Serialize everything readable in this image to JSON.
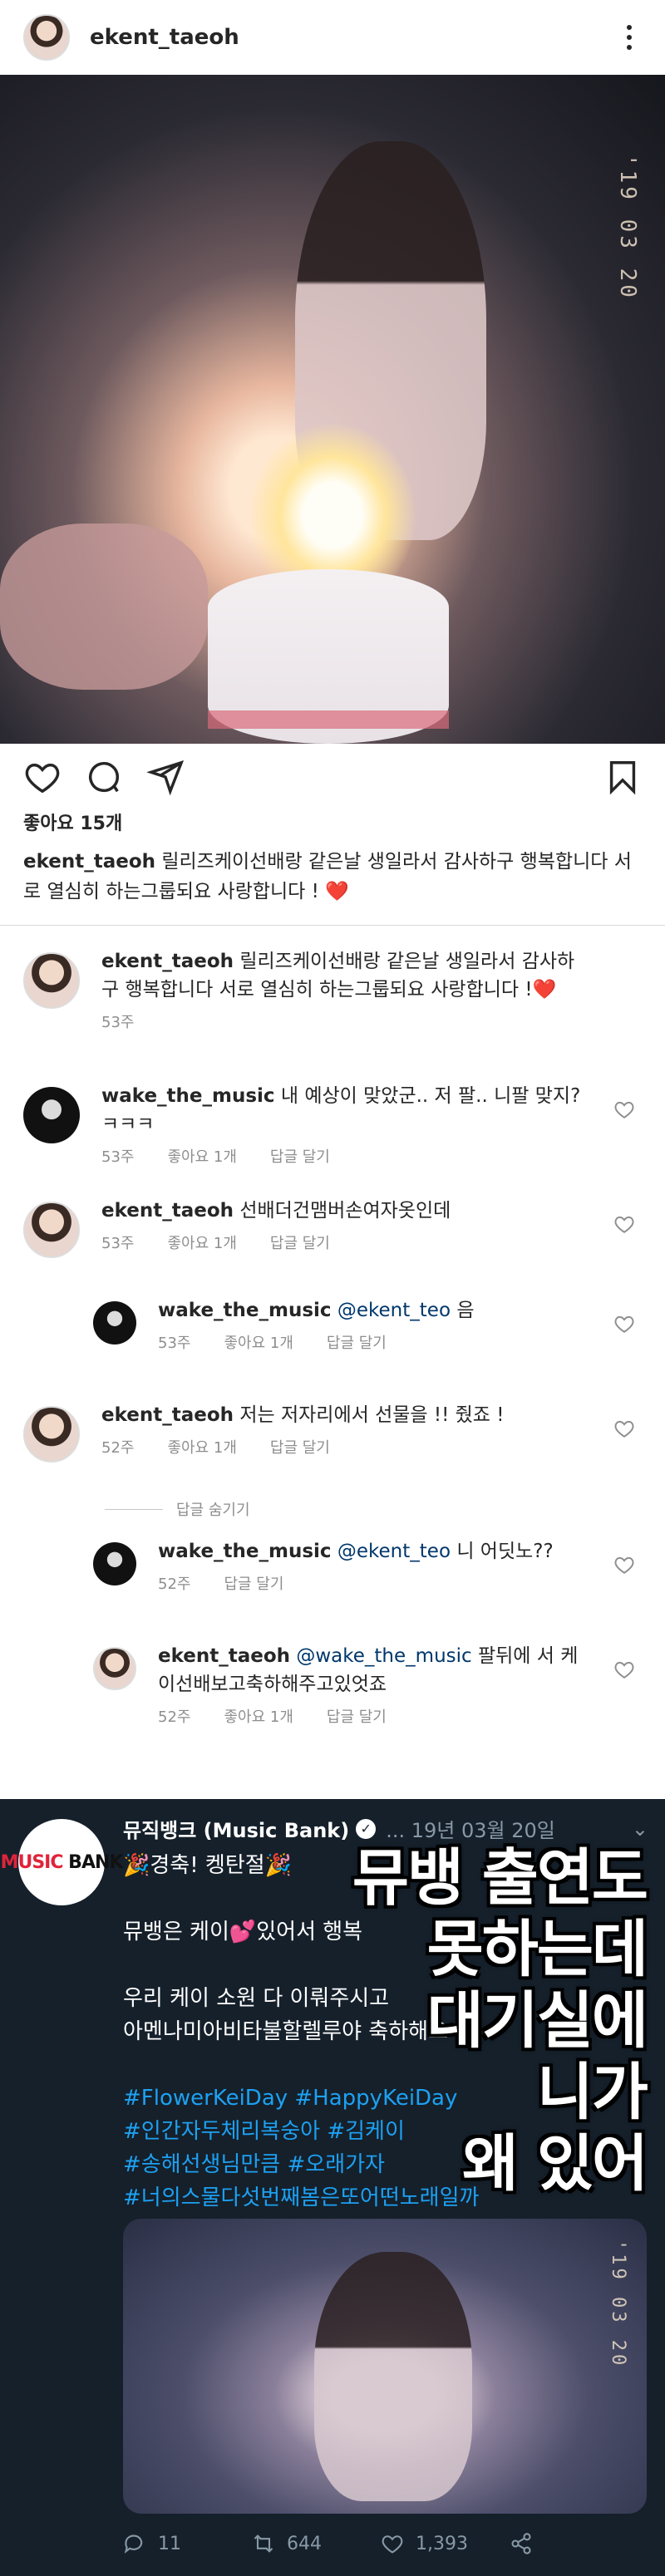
{
  "instagram": {
    "username": "ekent_taeoh",
    "likes": "좋아요 15개",
    "caption": {
      "user": "ekent_taeoh",
      "text": "릴리즈케이선배랑 같은날 생일라서 감사하구 행복합니다 서로 열심히 하는그룹되요 사랑합니다 !",
      "emoji": "❤️"
    },
    "photo_date": "'19 03 20",
    "comments": [
      {
        "user": "ekent_taeoh",
        "text": "릴리즈케이선배랑 같은날 생일라서 감사하구 행복합니다 서로 열심히 하는그룹되요 사랑합니다 !",
        "emoji": "❤️",
        "time": "53주",
        "likes": "",
        "reply": ""
      },
      {
        "user": "wake_the_music",
        "text": "내 예상이 맞았군.. 저 팔.. 니팔 맞지? ㅋㅋㅋ",
        "time": "53주",
        "likes": "좋아요 1개",
        "reply": "답글 달기"
      },
      {
        "user": "ekent_taeoh",
        "text": "선배더건맴버손여자옷인데",
        "time": "53주",
        "likes": "좋아요 1개",
        "reply": "답글 달기"
      },
      {
        "user": "wake_the_music",
        "mention": "@ekent_teo",
        "text": "음",
        "time": "53주",
        "likes": "좋아요 1개",
        "reply": "답글 달기"
      },
      {
        "user": "ekent_taeoh",
        "text": "저는 저자리에서  선물을 !! 줬죠 !",
        "time": "52주",
        "likes": "좋아요 1개",
        "reply": "답글 달기"
      },
      {
        "user": "wake_the_music",
        "mention": "@ekent_teo",
        "text": "니 어딧노??",
        "time": "52주",
        "likes": "",
        "reply": "답글 달기"
      },
      {
        "user": "ekent_taeoh",
        "mention": "@wake_the_music",
        "text": "팔뒤에 서 케이선배보고축하해주고있엇죠",
        "time": "52주",
        "likes": "좋아요 1개",
        "reply": "답글 달기"
      }
    ],
    "hide_replies": "답글 숨기기"
  },
  "twitter": {
    "avatar_text_a": "MUSIC",
    "avatar_text_b": "BANK",
    "name": "뮤직뱅크 (Music Bank)",
    "handle": "... 19년 03월 20일",
    "line1": "🎉경축! 켕탄절🎉",
    "line2": "뮤뱅은 케이💕있어서 행복",
    "line3": "우리 케이 소원 다 이뤄주시고",
    "line4": "아멘나미아비타불할렐루야 축하해요",
    "tags": [
      "#FlowerKeiDay #HappyKeiDay",
      "#인간자두체리복숭아 #김케이",
      "#송해선생님만큼 #오래가자",
      "#너의스물다섯번째봄은또어떤노래일까"
    ],
    "overlay": [
      "뮤뱅 출연도",
      "못하는데",
      "대기실에",
      "니가",
      "왜 있어"
    ],
    "photo_date": "'19 03 20",
    "replies": "11",
    "retweets": "644",
    "likes": "1,393"
  }
}
